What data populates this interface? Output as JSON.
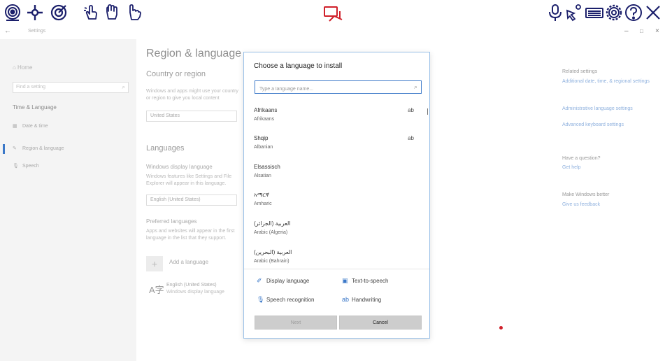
{
  "toolbar": {
    "icons": [
      "eye-gaze-icon",
      "crosshair-move-icon",
      "target-icon",
      "hand-tap-icon",
      "hand-swipe-icon",
      "hand-point-icon",
      "camera-icon",
      "microphone-icon",
      "touch-select-icon",
      "keyboard-icon",
      "gear-icon",
      "help-icon",
      "close-icon"
    ],
    "accent_color": "#1b1f6b",
    "camera_color": "#d0202a"
  },
  "window": {
    "title": "Settings",
    "back": "←",
    "minimize": "–",
    "maximize": "□",
    "close": "×"
  },
  "sidebar": {
    "home": "⌂  Home",
    "search_placeholder": "Find a setting",
    "section": "Time & Language",
    "items": [
      {
        "icon": "▦",
        "label": "Date & time"
      },
      {
        "icon": "✎",
        "label": "Region & language"
      },
      {
        "icon": "🎙",
        "label": "Speech"
      }
    ]
  },
  "main": {
    "title": "Region & language",
    "country_heading": "Country or region",
    "country_desc": "Windows and apps might use your country or region to give you local content",
    "country_value": "United States",
    "languages_heading": "Languages",
    "display_lang_label": "Windows display language",
    "display_lang_desc": "Windows features like Settings and File Explorer will appear in this language.",
    "display_lang_value": "English (United States)",
    "preferred_label": "Preferred languages",
    "preferred_desc": "Apps and websites will appear in the first language in the list that they support.",
    "add_button": "+",
    "add_label": "Add a language",
    "entry_icon": "A字",
    "entry_name": "English (United States)",
    "entry_sub": "Windows display language"
  },
  "related": {
    "heading": "Related settings",
    "link1": "Additional date, time, & regional settings",
    "link2": "Administrative language settings",
    "link3": "Advanced keyboard settings",
    "question": "Have a question?",
    "help": "Get help",
    "better": "Make Windows better",
    "feedback": "Give us feedback"
  },
  "dialog": {
    "title": "Choose a language to install",
    "search_placeholder": "Type a language name...",
    "search_icon": "⌕",
    "languages": [
      {
        "name": "Afrikaans",
        "english": "Afrikaans",
        "hw": "ab"
      },
      {
        "name": "Shqip",
        "english": "Albanian",
        "hw": "ab"
      },
      {
        "name": "Elsassisch",
        "english": "Alsatian",
        "hw": ""
      },
      {
        "name": "አማርኛ",
        "english": "Amharic",
        "hw": ""
      },
      {
        "name": "العربية (الجزائر)",
        "english": "Arabic (Algeria)",
        "hw": ""
      },
      {
        "name": "العربية (البحرين)",
        "english": "Arabic (Bahrain)",
        "hw": ""
      }
    ],
    "features": [
      {
        "icon": "✐",
        "label": "Display language"
      },
      {
        "icon": "▣",
        "label": "Text-to-speech"
      },
      {
        "icon": "🎙",
        "label": "Speech recognition"
      },
      {
        "icon": "ab",
        "label": "Handwriting"
      }
    ],
    "next": "Next",
    "cancel": "Cancel"
  }
}
